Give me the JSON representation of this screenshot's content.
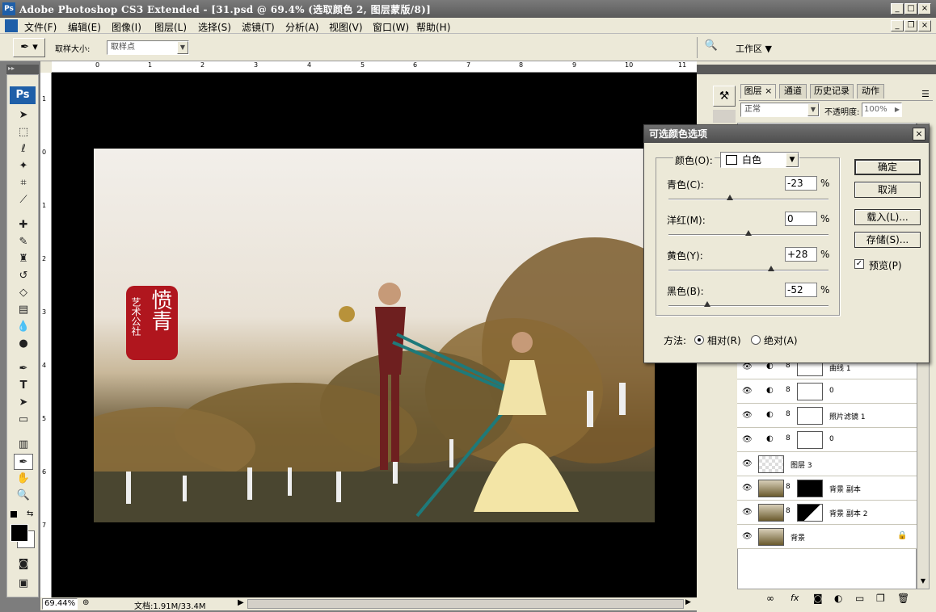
{
  "window": {
    "title": "Adobe Photoshop CS3 Extended - [31.psd @ 69.4% (选取颜色 2, 图层蒙版/8)]",
    "ps_badge": "Ps"
  },
  "menu": [
    "文件(F)",
    "编辑(E)",
    "图像(I)",
    "图层(L)",
    "选择(S)",
    "滤镜(T)",
    "分析(A)",
    "视图(V)",
    "窗口(W)",
    "帮助(H)"
  ],
  "options": {
    "sample_size_label": "取样大小:",
    "sample_size_value": "取样点",
    "workspace_label": "工作区 ▼"
  },
  "ruler": {
    "h": [
      "0",
      "1",
      "2",
      "3",
      "4",
      "5",
      "6",
      "7",
      "8",
      "9",
      "10",
      "11"
    ],
    "v": [
      "1",
      "0",
      "1",
      "2",
      "3",
      "4",
      "5",
      "6",
      "7"
    ]
  },
  "status": {
    "zoom": "69.44%",
    "doc": "文档:1.91M/33.4M"
  },
  "photo": {
    "stamp_chars_big": "愤青",
    "stamp_chars_small": "艺术公社"
  },
  "panel": {
    "tabs": [
      "图层",
      "通道",
      "历史记录",
      "动作"
    ],
    "blend_mode": "正常",
    "opacity_label": "不透明度:",
    "opacity_value": "100%",
    "layers": [
      {
        "name": "曲线 1"
      },
      {
        "name": "0"
      },
      {
        "name": "照片滤镜 1"
      },
      {
        "name": "0"
      },
      {
        "name": "图层 3"
      },
      {
        "name": "背景 副本"
      },
      {
        "name": "背景 副本 2"
      },
      {
        "name": "背景"
      }
    ]
  },
  "dialog": {
    "title": "可选颜色选项",
    "color_label": "颜色(O):",
    "color_value": "白色",
    "sliders": [
      {
        "label": "青色(C):",
        "value": "-23",
        "frac": 0.385
      },
      {
        "label": "洋红(M):",
        "value": "0",
        "frac": 0.5
      },
      {
        "label": "黄色(Y):",
        "value": "+28",
        "frac": 0.64
      },
      {
        "label": "黑色(B):",
        "value": "-52",
        "frac": 0.24
      }
    ],
    "pct": "%",
    "ok": "确定",
    "cancel": "取消",
    "load": "载入(L)...",
    "save": "存储(S)...",
    "preview": "预览(P)",
    "preview_checked": "✓",
    "method_label": "方法:",
    "relative": "相对(R)",
    "absolute": "绝对(A)"
  }
}
